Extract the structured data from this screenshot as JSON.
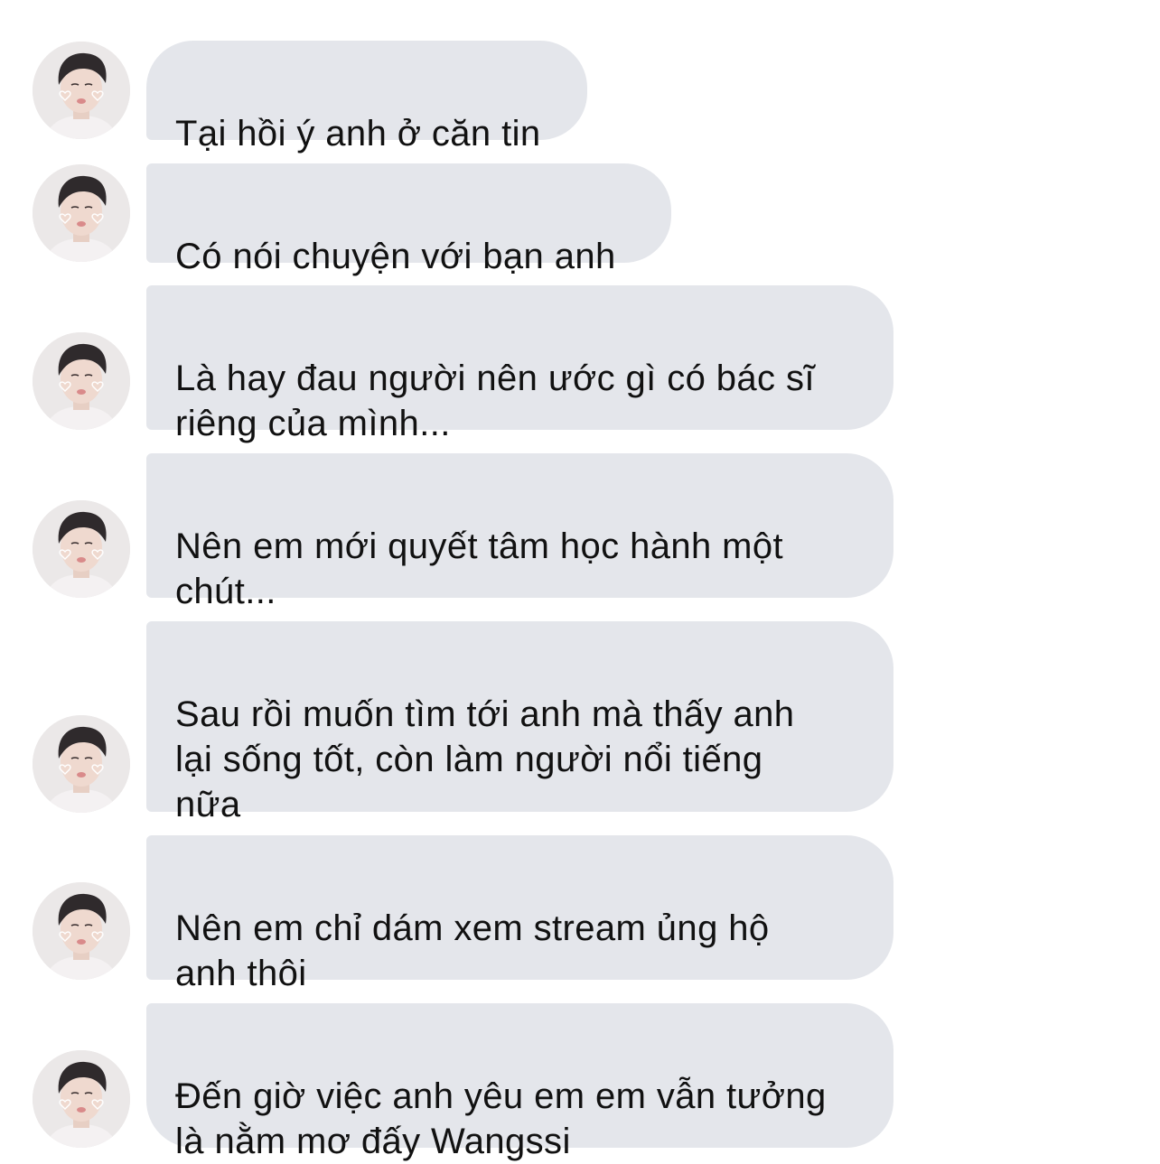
{
  "conversation": {
    "sender_avatar_icon": "user-avatar-photo",
    "bubble_color": "#e4e6eb",
    "text_color": "#111111",
    "messages": [
      {
        "text": "Tại hồi ý anh ở căn tin"
      },
      {
        "text": "Có nói chuyện với bạn anh"
      },
      {
        "text": "Là hay đau người nên ước gì có bác sĩ\nriêng của mình..."
      },
      {
        "text": "Nên em mới quyết tâm học hành một\nchút..."
      },
      {
        "text": "Sau rồi muốn tìm tới anh mà thấy anh\nlại sống tốt, còn làm người nổi tiếng\nnữa"
      },
      {
        "text": "Nên em chỉ dám xem stream ủng hộ\nanh thôi"
      },
      {
        "text": "Đến giờ việc anh yêu em em vẫn tưởng\nlà nằm mơ đấy Wangssi"
      }
    ]
  }
}
